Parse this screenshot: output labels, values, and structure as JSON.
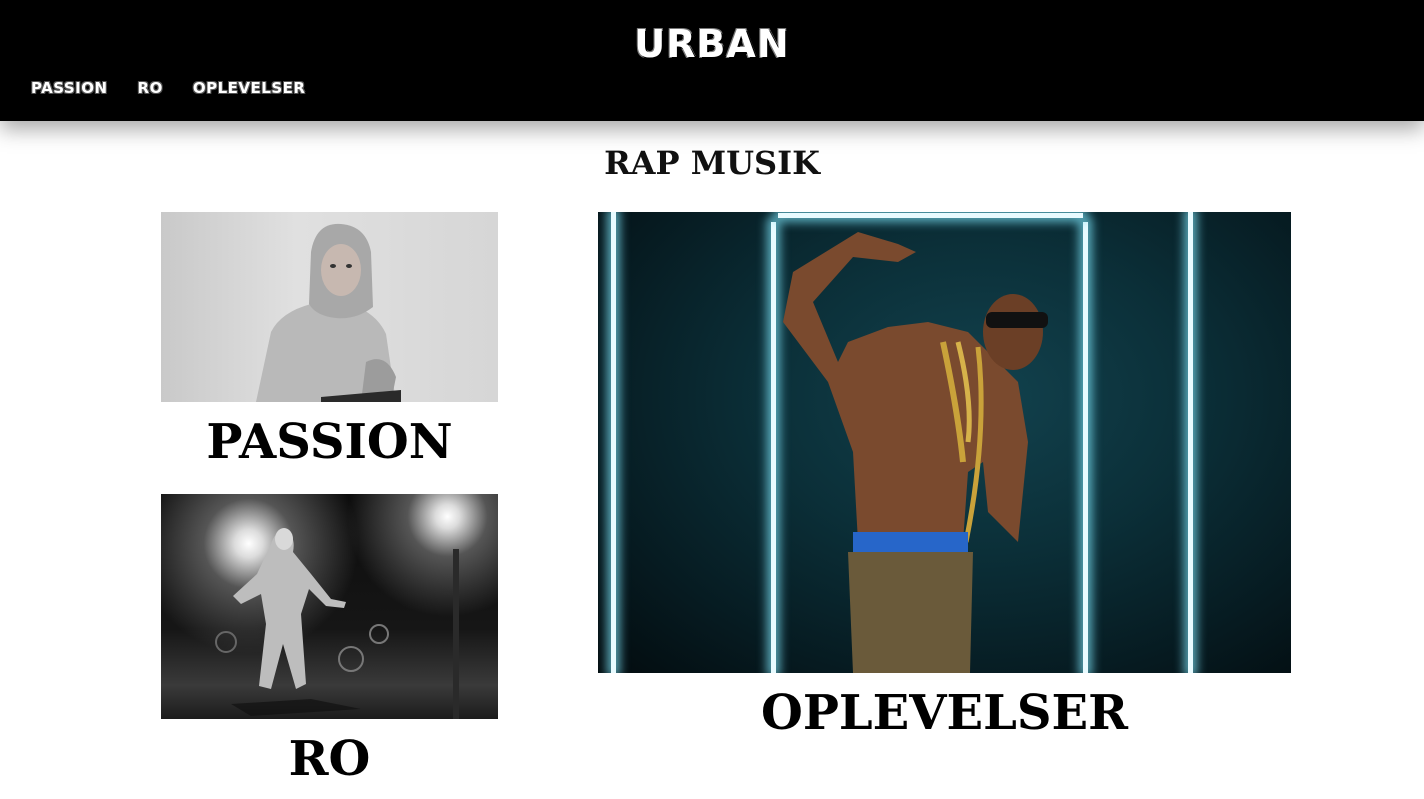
{
  "header": {
    "logo": "URBAN",
    "nav": [
      {
        "label": "PASSION"
      },
      {
        "label": "RO"
      },
      {
        "label": "OPLEVELSER"
      }
    ]
  },
  "main": {
    "title": "RAP MUSIK",
    "cards": [
      {
        "title": "PASSION",
        "image": "person-in-hoodie-photo"
      },
      {
        "title": "RO",
        "image": "person-under-stage-lights-photo"
      },
      {
        "title": "OPLEVELSER",
        "image": "rapper-with-gold-chains-photo"
      }
    ]
  },
  "colors": {
    "header_bg": "#000000",
    "page_bg": "#ffffff",
    "text": "#000000"
  }
}
